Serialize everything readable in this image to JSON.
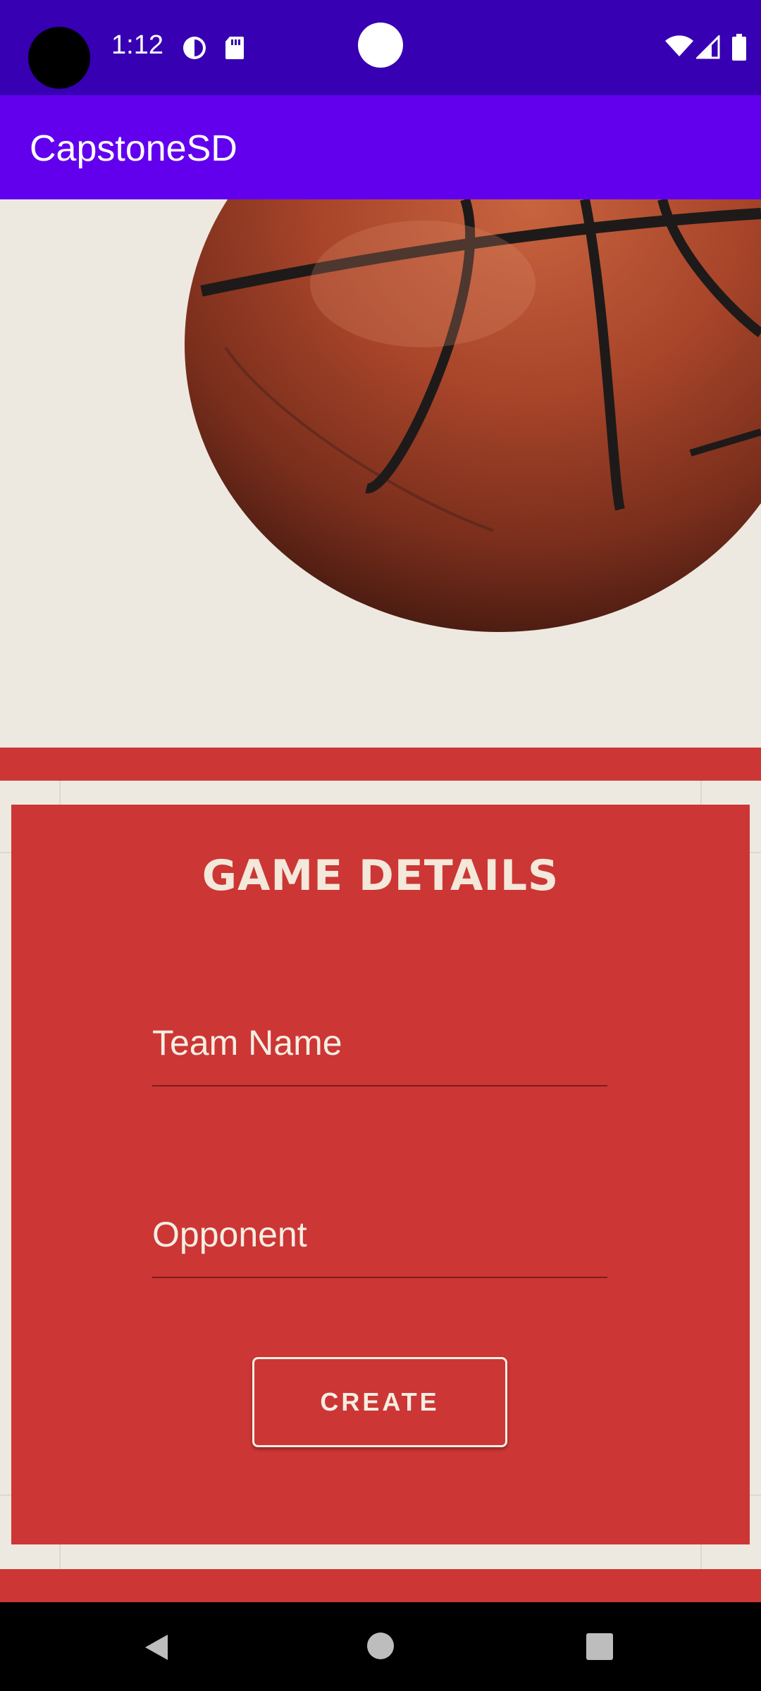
{
  "status_bar": {
    "time": "1:12",
    "icons": [
      "camera-cutout",
      "data-saver-icon",
      "sd-card-icon",
      "wifi-icon",
      "signal-icon",
      "battery-icon"
    ],
    "background_color": "#3700B3"
  },
  "app_bar": {
    "title": "CapstoneSD",
    "background_color": "#6200EE"
  },
  "hero": {
    "image": "basketball-image"
  },
  "game_details": {
    "title": "GAME DETAILS",
    "team_name_placeholder": "Team Name",
    "team_name_value": "",
    "opponent_placeholder": "Opponent",
    "opponent_value": "",
    "create_label": "CREATE",
    "card_color": "#CC3635",
    "court_color": "#EEE9E0"
  },
  "nav_bar": {
    "icons": [
      "back-icon",
      "home-icon",
      "recents-icon"
    ]
  }
}
